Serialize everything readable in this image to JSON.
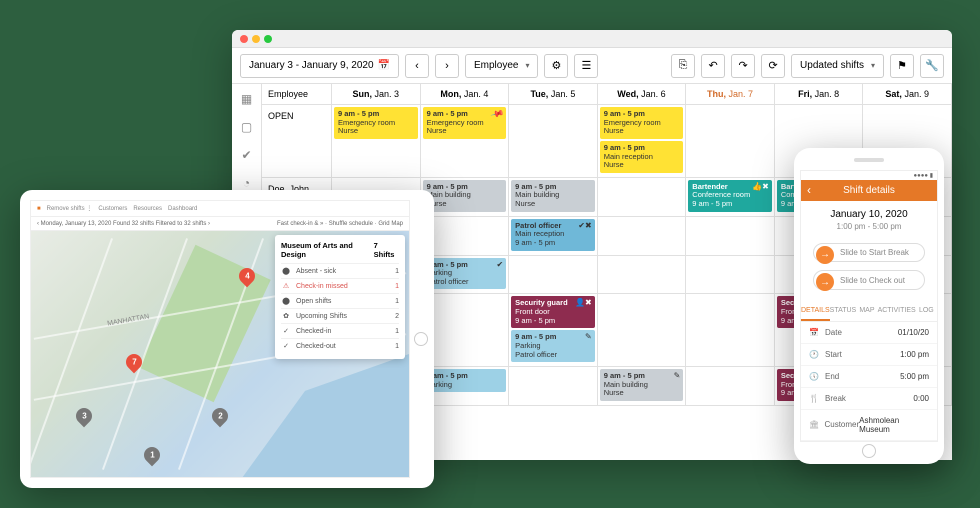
{
  "desktop": {
    "toolbar": {
      "date_range": "January 3 - January 9, 2020",
      "view_by": "Employee",
      "filter": "Updated shifts"
    },
    "columns": {
      "employee": "Employee",
      "days": [
        {
          "dow": "Sun,",
          "date": "Jan. 3"
        },
        {
          "dow": "Mon,",
          "date": "Jan. 4"
        },
        {
          "dow": "Tue,",
          "date": "Jan. 5"
        },
        {
          "dow": "Wed,",
          "date": "Jan. 6"
        },
        {
          "dow": "Thu,",
          "date": "Jan. 7"
        },
        {
          "dow": "Fri,",
          "date": "Jan. 8"
        },
        {
          "dow": "Sat,",
          "date": "Jan. 9"
        }
      ]
    },
    "rows": {
      "open": "OPEN",
      "doe": "Doe, John"
    },
    "shifts": {
      "er": {
        "time": "9 am - 5 pm",
        "loc": "Emergency room",
        "role": "Nurse"
      },
      "mr": {
        "time": "9 am - 5 pm",
        "loc": "Main reception",
        "role": "Nurse"
      },
      "mb": {
        "time": "9 am - 5 pm",
        "loc": "Main building",
        "role": "Nurse"
      },
      "bart": {
        "title": "Bartender",
        "loc": "Conference room",
        "time": "9 am - 5 pm"
      },
      "patrol": {
        "title": "Patrol officer",
        "loc": "Main reception",
        "time": "9 am - 5 pm"
      },
      "park": {
        "time": "9 am - 5 pm",
        "loc": "Parking",
        "role": "Patrol officer"
      },
      "sec": {
        "title": "Security guard",
        "loc": "Front door",
        "time": "9 am - 5 pm"
      }
    }
  },
  "tablet": {
    "top": {
      "remove": "Remove shifts ⋮",
      "customers": "Customers",
      "resources": "Resources",
      "dashboard": "Dashboard"
    },
    "sub": {
      "date": "Monday, January 13, 2020  Found 32 shifts  Filtered to 32 shifts",
      "fast": "Fast check-in & »",
      "shuffle": "Shuffle schedule",
      "grid": "Grid  Map"
    },
    "map_label": "MANHATTAN",
    "popup": {
      "title": "Museum of Arts and Design",
      "count": "7 Shifts",
      "rows": [
        {
          "icon": "⬤",
          "label": "Absent - sick",
          "n": "1"
        },
        {
          "icon": "⚠",
          "label": "Check-in missed",
          "n": "1",
          "red": true
        },
        {
          "icon": "⬤",
          "label": "Open shifts",
          "n": "1"
        },
        {
          "icon": "✿",
          "label": "Upcoming Shifts",
          "n": "2"
        },
        {
          "icon": "✓",
          "label": "Checked-in",
          "n": "1"
        },
        {
          "icon": "✓",
          "label": "Checked-out",
          "n": "1"
        }
      ]
    }
  },
  "phone": {
    "header": "Shift details",
    "date": "January 10, 2020",
    "time": "1:00 pm - 5:00 pm",
    "slide1": "Slide to Start Break",
    "slide2": "Slide to Check out",
    "tabs": [
      "DETAILS",
      "STATUS",
      "MAP",
      "ACTIVITIES",
      "LOG"
    ],
    "rows": [
      {
        "icon": "📅",
        "label": "Date",
        "value": "01/10/20"
      },
      {
        "icon": "🕐",
        "label": "Start",
        "value": "1:00 pm"
      },
      {
        "icon": "🕔",
        "label": "End",
        "value": "5:00 pm"
      },
      {
        "icon": "🍴",
        "label": "Break",
        "value": "0:00"
      },
      {
        "icon": "🏛",
        "label": "Customer",
        "value": "Ashmolean Museum"
      }
    ]
  }
}
